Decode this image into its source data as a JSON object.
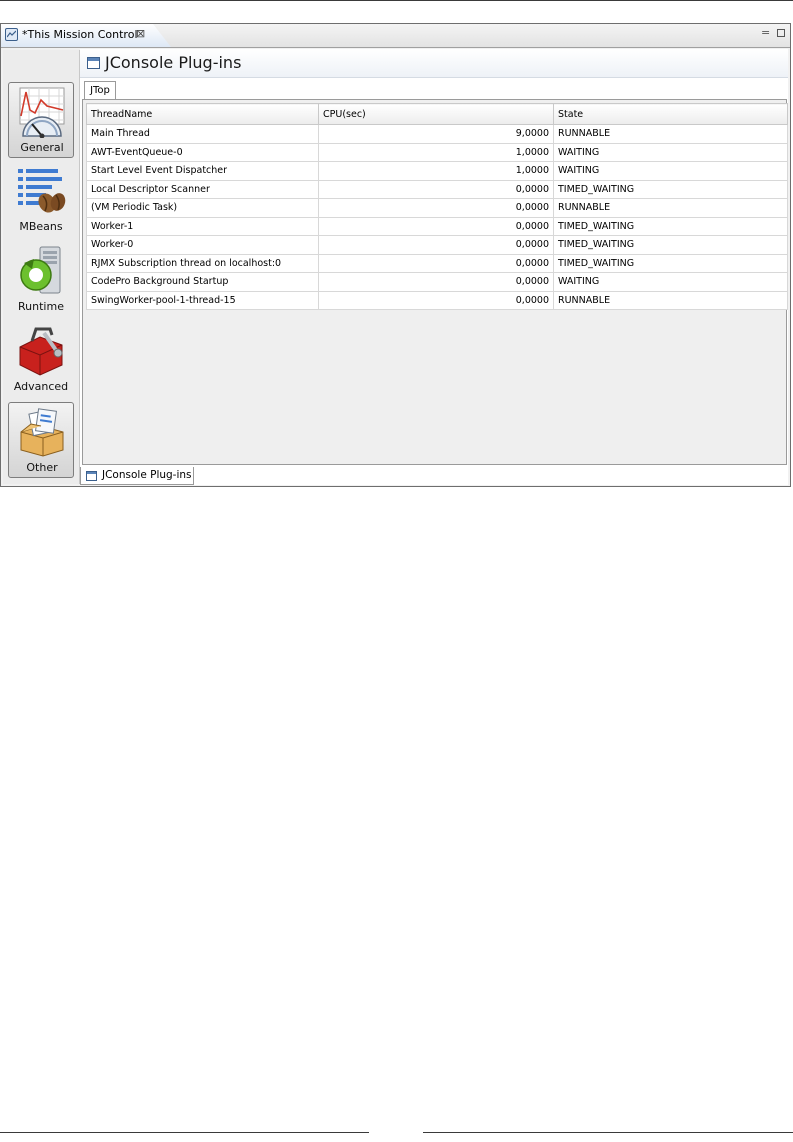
{
  "editor_tab": {
    "title": "*This Mission Control",
    "close_glyph": "⊠",
    "icon": "mission-control-icon"
  },
  "window_controls": {
    "minimize_glyph": "=",
    "maximize_icon": "maximize-icon"
  },
  "sidebar": {
    "items": [
      {
        "label": "General",
        "icon": "speedometer-icon",
        "selected": true
      },
      {
        "label": "MBeans",
        "icon": "coffee-beans-icon",
        "selected": false
      },
      {
        "label": "Runtime",
        "icon": "server-refresh-icon",
        "selected": false
      },
      {
        "label": "Advanced",
        "icon": "toolbox-icon",
        "selected": false
      },
      {
        "label": "Other",
        "icon": "box-icon",
        "selected": false
      }
    ]
  },
  "page": {
    "title": "JConsole Plug-ins",
    "icon": "plugin-page-icon"
  },
  "subtabs": [
    {
      "label": "JTop"
    }
  ],
  "table": {
    "columns": [
      "ThreadName",
      "CPU(sec)",
      "State"
    ],
    "rows": [
      {
        "name": "Main Thread",
        "cpu": "9,0000",
        "state": "RUNNABLE"
      },
      {
        "name": "AWT-EventQueue-0",
        "cpu": "1,0000",
        "state": "WAITING"
      },
      {
        "name": "Start Level Event Dispatcher",
        "cpu": "1,0000",
        "state": "WAITING"
      },
      {
        "name": "Local Descriptor Scanner",
        "cpu": "0,0000",
        "state": "TIMED_WAITING"
      },
      {
        "name": "(VM Periodic Task)",
        "cpu": "0,0000",
        "state": "RUNNABLE"
      },
      {
        "name": "Worker-1",
        "cpu": "0,0000",
        "state": "TIMED_WAITING"
      },
      {
        "name": "Worker-0",
        "cpu": "0,0000",
        "state": "TIMED_WAITING"
      },
      {
        "name": "RJMX Subscription thread on localhost:0",
        "cpu": "0,0000",
        "state": "TIMED_WAITING"
      },
      {
        "name": "CodePro Background Startup",
        "cpu": "0,0000",
        "state": "WAITING"
      },
      {
        "name": "SwingWorker-pool-1-thread-15",
        "cpu": "0,0000",
        "state": "RUNNABLE"
      }
    ]
  },
  "bottom_tab": {
    "label": "JConsole Plug-ins",
    "icon": "plugin-page-icon"
  }
}
